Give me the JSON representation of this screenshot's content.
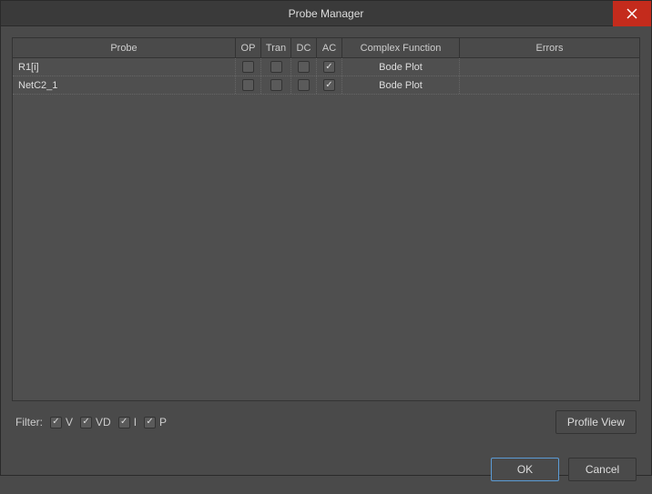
{
  "window": {
    "title": "Probe Manager"
  },
  "table": {
    "headers": {
      "probe": "Probe",
      "op": "OP",
      "tran": "Tran",
      "dc": "DC",
      "ac": "AC",
      "complex": "Complex Function",
      "errors": "Errors"
    },
    "rows": [
      {
        "probe": "R1[i]",
        "op": false,
        "tran": false,
        "dc": false,
        "ac": true,
        "complex": "Bode Plot",
        "errors": ""
      },
      {
        "probe": "NetC2_1",
        "op": false,
        "tran": false,
        "dc": false,
        "ac": true,
        "complex": "Bode Plot",
        "errors": ""
      }
    ]
  },
  "filter": {
    "label": "Filter:",
    "v": {
      "label": "V",
      "checked": true
    },
    "vd": {
      "label": "VD",
      "checked": true
    },
    "i": {
      "label": "I",
      "checked": true
    },
    "p": {
      "label": "P",
      "checked": true
    }
  },
  "buttons": {
    "profile_view": "Profile View",
    "ok": "OK",
    "cancel": "Cancel"
  }
}
